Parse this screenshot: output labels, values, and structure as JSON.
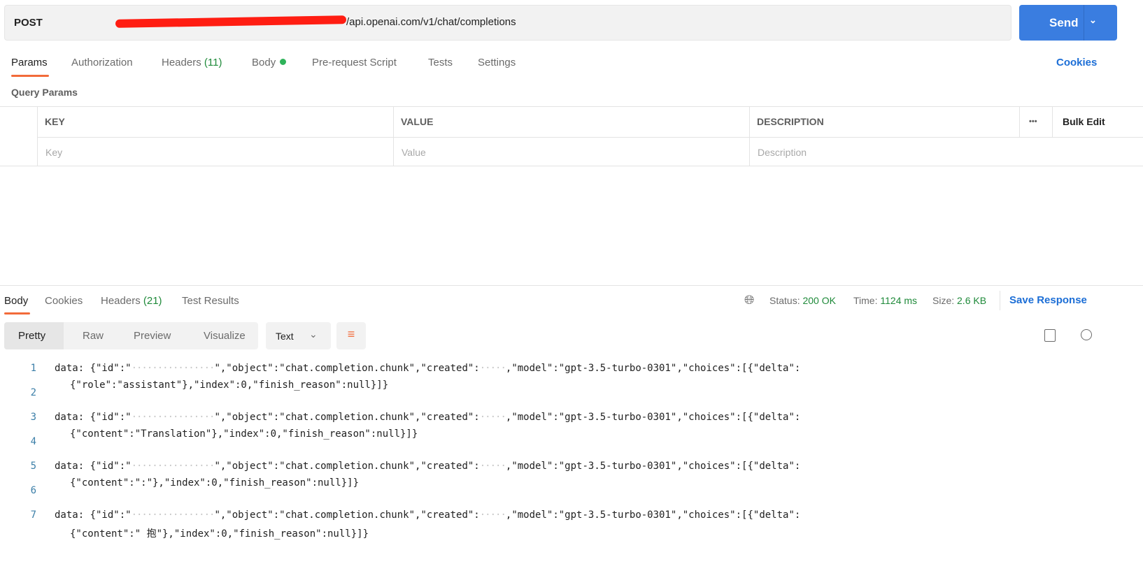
{
  "request": {
    "method": "POST",
    "url_suffix": "/api.openai.com/v1/chat/completions",
    "send_label": "Send"
  },
  "tabs": [
    {
      "label": "Params"
    },
    {
      "label": "Authorization"
    },
    {
      "label": "Headers",
      "count": "(11)"
    },
    {
      "label": "Body"
    },
    {
      "label": "Pre-request Script"
    },
    {
      "label": "Tests"
    },
    {
      "label": "Settings"
    }
  ],
  "cookies_label": "Cookies",
  "query_params": {
    "title": "Query Params",
    "headers": [
      "KEY",
      "VALUE",
      "DESCRIPTION"
    ],
    "placeholders": [
      "Key",
      "Value",
      "Description"
    ],
    "bulk_edit": "Bulk Edit",
    "more": "•••"
  },
  "response": {
    "tabs": [
      {
        "label": "Body"
      },
      {
        "label": "Cookies"
      },
      {
        "label": "Headers",
        "count": "(21)"
      },
      {
        "label": "Test Results"
      }
    ],
    "status_label": "Status:",
    "status": "200 OK",
    "time_label": "Time:",
    "time": "1124 ms",
    "size_label": "Size:",
    "size": "2.6 KB",
    "save_label": "Save Response",
    "views": [
      "Pretty",
      "Raw",
      "Preview",
      "Visualize"
    ],
    "format": "Text",
    "lines": [
      {
        "n": "1",
        "a": "data: {\"id\":\"",
        "mid": "\",\"object\":\"chat.completion.chunk\",\"created\":",
        "b": ",\"model\":\"gpt-3.5-turbo-0301\",\"choices\":[{\"delta\":",
        "cont": "{\"role\":\"assistant\"},\"index\":0,\"finish_reason\":null}]}"
      },
      {
        "n": "2"
      },
      {
        "n": "3",
        "a": "data: {\"id\":\"",
        "mid": "\",\"object\":\"chat.completion.chunk\",\"created\":",
        "b": ",\"model\":\"gpt-3.5-turbo-0301\",\"choices\":[{\"delta\":",
        "cont": "{\"content\":\"Translation\"},\"index\":0,\"finish_reason\":null}]}"
      },
      {
        "n": "4"
      },
      {
        "n": "5",
        "a": "data: {\"id\":\"",
        "mid": "\",\"object\":\"chat.completion.chunk\",\"created\":",
        "b": ",\"model\":\"gpt-3.5-turbo-0301\",\"choices\":[{\"delta\":",
        "cont": "{\"content\":\":\"},\"index\":0,\"finish_reason\":null}]}"
      },
      {
        "n": "6"
      },
      {
        "n": "7",
        "a": "data: {\"id\":\"",
        "mid": "\",\"object\":\"chat.completion.chunk\",\"created\":",
        "b": ",\"model\":\"gpt-3.5-turbo-0301\",\"choices\":[{\"delta\":",
        "cont": "{\"content\":\" 抱\"},\"index\":0,\"finish_reason\":null}]}"
      }
    ]
  },
  "colors": {
    "accent": "#f26b3a",
    "send": "#3a7de0",
    "link": "#1c6ed6",
    "success": "#1f8a3a"
  }
}
